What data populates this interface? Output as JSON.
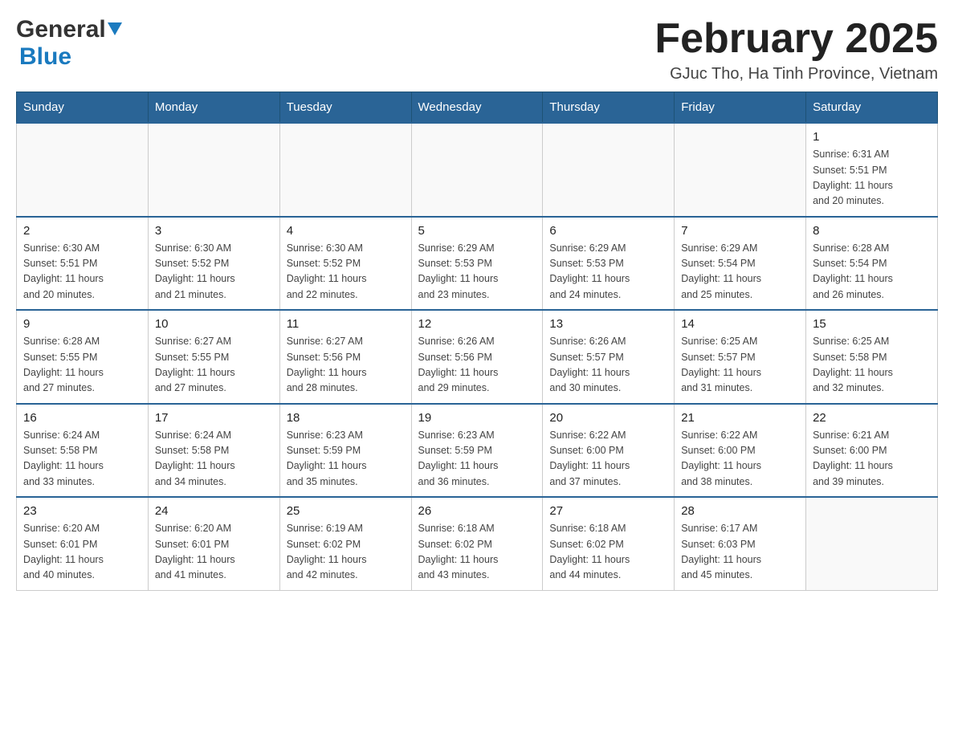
{
  "header": {
    "logo_general": "General",
    "logo_blue": "Blue",
    "month_title": "February 2025",
    "location": "GJuc Tho, Ha Tinh Province, Vietnam"
  },
  "days_of_week": [
    "Sunday",
    "Monday",
    "Tuesday",
    "Wednesday",
    "Thursday",
    "Friday",
    "Saturday"
  ],
  "weeks": [
    [
      {
        "day": "",
        "info": ""
      },
      {
        "day": "",
        "info": ""
      },
      {
        "day": "",
        "info": ""
      },
      {
        "day": "",
        "info": ""
      },
      {
        "day": "",
        "info": ""
      },
      {
        "day": "",
        "info": ""
      },
      {
        "day": "1",
        "info": "Sunrise: 6:31 AM\nSunset: 5:51 PM\nDaylight: 11 hours\nand 20 minutes."
      }
    ],
    [
      {
        "day": "2",
        "info": "Sunrise: 6:30 AM\nSunset: 5:51 PM\nDaylight: 11 hours\nand 20 minutes."
      },
      {
        "day": "3",
        "info": "Sunrise: 6:30 AM\nSunset: 5:52 PM\nDaylight: 11 hours\nand 21 minutes."
      },
      {
        "day": "4",
        "info": "Sunrise: 6:30 AM\nSunset: 5:52 PM\nDaylight: 11 hours\nand 22 minutes."
      },
      {
        "day": "5",
        "info": "Sunrise: 6:29 AM\nSunset: 5:53 PM\nDaylight: 11 hours\nand 23 minutes."
      },
      {
        "day": "6",
        "info": "Sunrise: 6:29 AM\nSunset: 5:53 PM\nDaylight: 11 hours\nand 24 minutes."
      },
      {
        "day": "7",
        "info": "Sunrise: 6:29 AM\nSunset: 5:54 PM\nDaylight: 11 hours\nand 25 minutes."
      },
      {
        "day": "8",
        "info": "Sunrise: 6:28 AM\nSunset: 5:54 PM\nDaylight: 11 hours\nand 26 minutes."
      }
    ],
    [
      {
        "day": "9",
        "info": "Sunrise: 6:28 AM\nSunset: 5:55 PM\nDaylight: 11 hours\nand 27 minutes."
      },
      {
        "day": "10",
        "info": "Sunrise: 6:27 AM\nSunset: 5:55 PM\nDaylight: 11 hours\nand 27 minutes."
      },
      {
        "day": "11",
        "info": "Sunrise: 6:27 AM\nSunset: 5:56 PM\nDaylight: 11 hours\nand 28 minutes."
      },
      {
        "day": "12",
        "info": "Sunrise: 6:26 AM\nSunset: 5:56 PM\nDaylight: 11 hours\nand 29 minutes."
      },
      {
        "day": "13",
        "info": "Sunrise: 6:26 AM\nSunset: 5:57 PM\nDaylight: 11 hours\nand 30 minutes."
      },
      {
        "day": "14",
        "info": "Sunrise: 6:25 AM\nSunset: 5:57 PM\nDaylight: 11 hours\nand 31 minutes."
      },
      {
        "day": "15",
        "info": "Sunrise: 6:25 AM\nSunset: 5:58 PM\nDaylight: 11 hours\nand 32 minutes."
      }
    ],
    [
      {
        "day": "16",
        "info": "Sunrise: 6:24 AM\nSunset: 5:58 PM\nDaylight: 11 hours\nand 33 minutes."
      },
      {
        "day": "17",
        "info": "Sunrise: 6:24 AM\nSunset: 5:58 PM\nDaylight: 11 hours\nand 34 minutes."
      },
      {
        "day": "18",
        "info": "Sunrise: 6:23 AM\nSunset: 5:59 PM\nDaylight: 11 hours\nand 35 minutes."
      },
      {
        "day": "19",
        "info": "Sunrise: 6:23 AM\nSunset: 5:59 PM\nDaylight: 11 hours\nand 36 minutes."
      },
      {
        "day": "20",
        "info": "Sunrise: 6:22 AM\nSunset: 6:00 PM\nDaylight: 11 hours\nand 37 minutes."
      },
      {
        "day": "21",
        "info": "Sunrise: 6:22 AM\nSunset: 6:00 PM\nDaylight: 11 hours\nand 38 minutes."
      },
      {
        "day": "22",
        "info": "Sunrise: 6:21 AM\nSunset: 6:00 PM\nDaylight: 11 hours\nand 39 minutes."
      }
    ],
    [
      {
        "day": "23",
        "info": "Sunrise: 6:20 AM\nSunset: 6:01 PM\nDaylight: 11 hours\nand 40 minutes."
      },
      {
        "day": "24",
        "info": "Sunrise: 6:20 AM\nSunset: 6:01 PM\nDaylight: 11 hours\nand 41 minutes."
      },
      {
        "day": "25",
        "info": "Sunrise: 6:19 AM\nSunset: 6:02 PM\nDaylight: 11 hours\nand 42 minutes."
      },
      {
        "day": "26",
        "info": "Sunrise: 6:18 AM\nSunset: 6:02 PM\nDaylight: 11 hours\nand 43 minutes."
      },
      {
        "day": "27",
        "info": "Sunrise: 6:18 AM\nSunset: 6:02 PM\nDaylight: 11 hours\nand 44 minutes."
      },
      {
        "day": "28",
        "info": "Sunrise: 6:17 AM\nSunset: 6:03 PM\nDaylight: 11 hours\nand 45 minutes."
      },
      {
        "day": "",
        "info": ""
      }
    ]
  ]
}
